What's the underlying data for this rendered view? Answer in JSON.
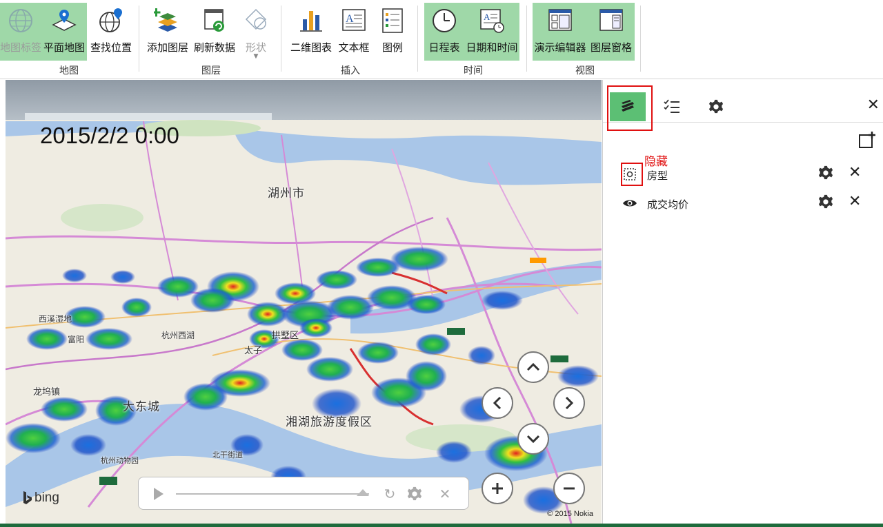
{
  "ribbon": {
    "groups": [
      {
        "label": "地图",
        "buttons": [
          {
            "label": "地图标签",
            "icon": "globe-icon",
            "active": true,
            "disabled": true
          },
          {
            "label": "平面地图",
            "icon": "flat-map-pin-icon",
            "active": true
          },
          {
            "label": "查找位置",
            "icon": "globe-pin-icon"
          }
        ]
      },
      {
        "label": "图层",
        "buttons": [
          {
            "label": "添加图层",
            "icon": "add-layer-icon"
          },
          {
            "label": "刷新数据",
            "icon": "refresh-data-icon"
          },
          {
            "label": "形状",
            "icon": "shape-icon",
            "disabled": true
          }
        ]
      },
      {
        "label": "插入",
        "buttons": [
          {
            "label": "二维图表",
            "icon": "bar-chart-icon"
          },
          {
            "label": "文本框",
            "icon": "text-box-icon"
          },
          {
            "label": "图例",
            "icon": "legend-icon"
          }
        ]
      },
      {
        "label": "时间",
        "buttons": [
          {
            "label": "日程表",
            "icon": "clock-icon",
            "active": true
          },
          {
            "label": "日期和时间",
            "icon": "date-time-icon",
            "active": true
          }
        ]
      },
      {
        "label": "视图",
        "buttons": [
          {
            "label": "演示编辑器",
            "icon": "tour-editor-icon",
            "active": true
          },
          {
            "label": "图层窗格",
            "icon": "layer-pane-icon",
            "active": true
          }
        ]
      }
    ]
  },
  "map": {
    "timestamp": "2015/2/2 0:00",
    "labels": {
      "huzhou": "湖州市",
      "jiadingqu": "西溪湿地",
      "hangzhou_w": "杭州西湖",
      "gongshu": "拱墅区",
      "taizi": "太子",
      "wanlu": "龙坞镇",
      "fuyang": "富阳",
      "xiangxiang": "大东城",
      "xianghu": "湘湖旅游度假区",
      "bottom_left": "杭州动物园",
      "yu_town": "北干街道"
    },
    "bing": "bing",
    "copyright": "© 2015 Nokia"
  },
  "panel": {
    "hide_note": "隐藏",
    "layers": [
      {
        "name": "房型",
        "visible": false
      },
      {
        "name": "成交均价",
        "visible": true
      }
    ]
  },
  "colors": {
    "accent": "#5cbf74",
    "ribbon_active": "#9fd8a8",
    "annotation": "#e01010"
  }
}
